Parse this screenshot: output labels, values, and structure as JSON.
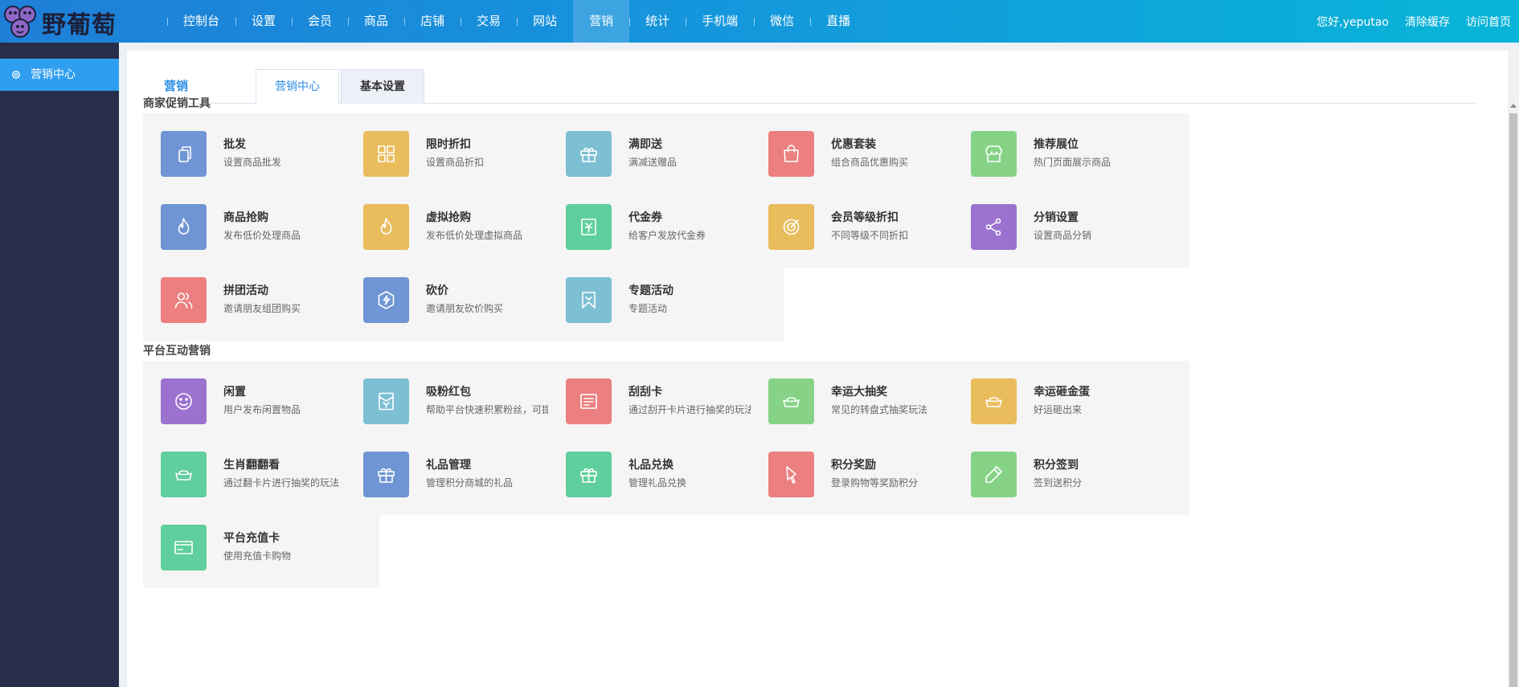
{
  "brand": {
    "logo_text": "野葡萄"
  },
  "nav": [
    {
      "label": "控制台",
      "active": false
    },
    {
      "label": "设置",
      "active": false
    },
    {
      "label": "会员",
      "active": false
    },
    {
      "label": "商品",
      "active": false
    },
    {
      "label": "店铺",
      "active": false
    },
    {
      "label": "交易",
      "active": false
    },
    {
      "label": "网站",
      "active": false
    },
    {
      "label": "营销",
      "active": true
    },
    {
      "label": "统计",
      "active": false
    },
    {
      "label": "手机端",
      "active": false
    },
    {
      "label": "微信",
      "active": false
    },
    {
      "label": "直播",
      "active": false
    }
  ],
  "topright": {
    "greeting": "您好,yeputao",
    "clear_cache": "清除缓存",
    "visit_home": "访问首页"
  },
  "sidebar": {
    "items": [
      {
        "label": "营销中心",
        "icon": "gear-icon"
      }
    ]
  },
  "tabs": {
    "heading": "营销",
    "items": [
      "营销中心",
      "基本设置"
    ],
    "active": 0
  },
  "sections": [
    {
      "title": "商家促销工具",
      "cards": [
        {
          "title": "批发",
          "desc": "设置商品批发",
          "color": "#6f95d4",
          "icon": "copy-icon"
        },
        {
          "title": "限时折扣",
          "desc": "设置商品折扣",
          "color": "#e9bc5c",
          "icon": "grid-icon"
        },
        {
          "title": "满即送",
          "desc": "满减送赠品",
          "color": "#7dbfd3",
          "icon": "gift-icon"
        },
        {
          "title": "优惠套装",
          "desc": "组合商品优惠购买",
          "color": "#ec7f7f",
          "icon": "bag-icon"
        },
        {
          "title": "推荐展位",
          "desc": "热门页面展示商品",
          "color": "#86d387",
          "icon": "shop-icon"
        },
        {
          "title": "商品抢购",
          "desc": "发布低价处理商品",
          "color": "#6f95d4",
          "icon": "fire-icon"
        },
        {
          "title": "虚拟抢购",
          "desc": "发布低价处理虚拟商品",
          "color": "#e9bc5c",
          "icon": "fire-icon"
        },
        {
          "title": "代金券",
          "desc": "给客户发放代金券",
          "color": "#5fcf9d",
          "icon": "voucher-icon"
        },
        {
          "title": "会员等级折扣",
          "desc": "不同等级不同折扣",
          "color": "#e9bc5c",
          "icon": "target-icon"
        },
        {
          "title": "分销设置",
          "desc": "设置商品分销",
          "color": "#9b72d0",
          "icon": "share-icon"
        },
        {
          "title": "拼团活动",
          "desc": "邀请朋友组团购买",
          "color": "#ec7f7f",
          "icon": "users-icon"
        },
        {
          "title": "砍价",
          "desc": "邀请朋友砍价购买",
          "color": "#6f95d4",
          "icon": "bolt-icon"
        },
        {
          "title": "专题活动",
          "desc": "专题活动",
          "color": "#7dbfd3",
          "icon": "bookmark-icon"
        }
      ]
    },
    {
      "title": "平台互动营销",
      "cards": [
        {
          "title": "闲置",
          "desc": "用户发布闲置物品",
          "color": "#9b72d0",
          "icon": "smile-icon"
        },
        {
          "title": "吸粉红包",
          "desc": "帮助平台快速积累粉丝，可提现",
          "color": "#7dbfd3",
          "icon": "redpacket-icon"
        },
        {
          "title": "刮刮卡",
          "desc": "通过刮开卡片进行抽奖的玩法",
          "color": "#ec7f7f",
          "icon": "card-icon"
        },
        {
          "title": "幸运大抽奖",
          "desc": "常见的转盘式抽奖玩法",
          "color": "#86d387",
          "icon": "ingot-icon"
        },
        {
          "title": "幸运砸金蛋",
          "desc": "好运砸出来",
          "color": "#e9bc5c",
          "icon": "ingot-icon"
        },
        {
          "title": "生肖翻翻看",
          "desc": "通过翻卡片进行抽奖的玩法",
          "color": "#5fcf9d",
          "icon": "ingot-icon"
        },
        {
          "title": "礼品管理",
          "desc": "管理积分商城的礼品",
          "color": "#6f95d4",
          "icon": "gift-icon"
        },
        {
          "title": "礼品兑换",
          "desc": "管理礼品兑换",
          "color": "#5fcf9d",
          "icon": "gift-icon"
        },
        {
          "title": "积分奖励",
          "desc": "登录购物等奖励积分",
          "color": "#ec7f7f",
          "icon": "pen-icon"
        },
        {
          "title": "积分签到",
          "desc": "签到送积分",
          "color": "#86d387",
          "icon": "pencil-icon"
        },
        {
          "title": "平台充值卡",
          "desc": "使用充值卡购物",
          "color": "#5fcf9d",
          "icon": "creditcard-icon"
        }
      ]
    }
  ]
}
